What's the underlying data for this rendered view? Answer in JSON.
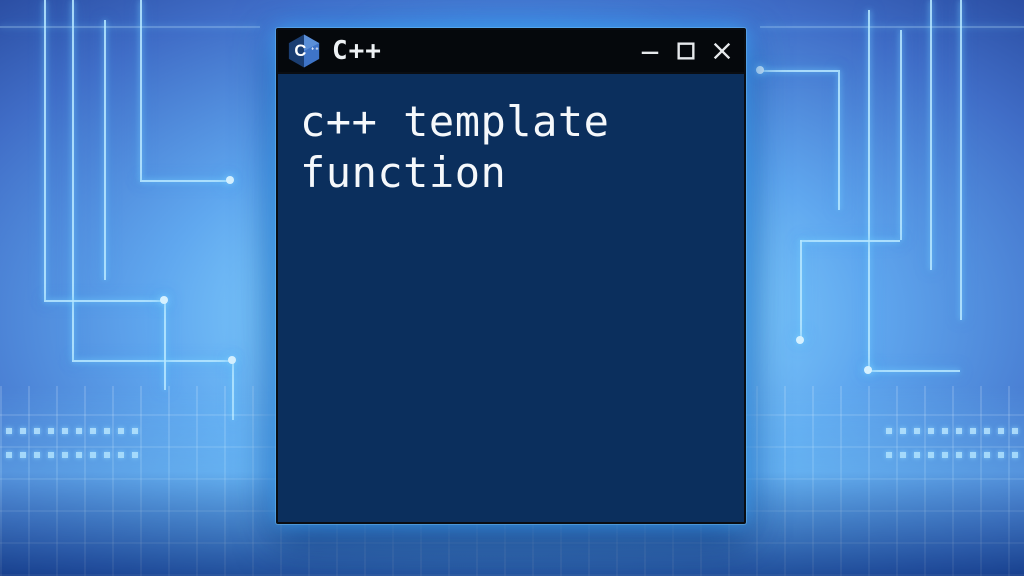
{
  "window": {
    "title": "C++",
    "icon_letter": "C",
    "icon_plus": "++"
  },
  "content": {
    "body_text": "c++ template\nfunction"
  },
  "colors": {
    "window_bg": "#0b2f5d",
    "titlebar_bg": "#05080c",
    "glow": "#5ab8ff",
    "icon_hex_dark": "#1b3e72",
    "icon_hex_light": "#3e74c8",
    "text": "#f5f8fb"
  }
}
